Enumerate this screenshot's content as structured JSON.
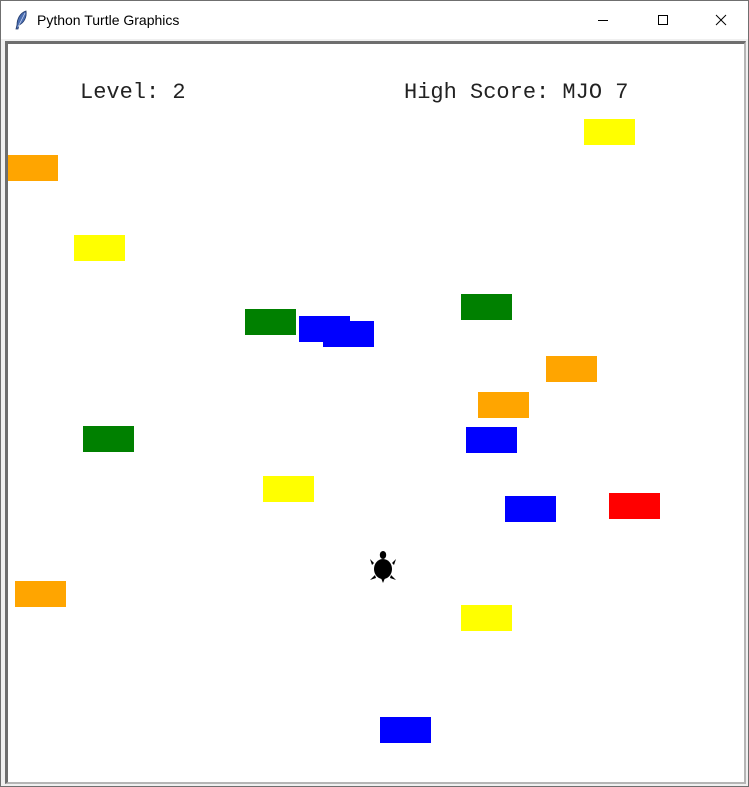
{
  "window": {
    "title": "Python Turtle Graphics",
    "icon": "feather-icon",
    "controls": [
      "minimize-icon",
      "maximize-icon",
      "close-icon"
    ]
  },
  "hud": {
    "level": "Level: 2",
    "high_score": "High Score: MJO 7"
  },
  "colors": {
    "orange": "#ffa500",
    "yellow": "#ffff00",
    "green": "#008000",
    "blue": "#0000ff",
    "red": "#ff0000",
    "turtle": "#000000"
  },
  "player": {
    "shape": "turtle",
    "color": "#000000"
  },
  "blocks": [
    {
      "color": "#ffff00"
    },
    {
      "color": "#ffa500"
    },
    {
      "color": "#ffff00"
    },
    {
      "color": "#008000"
    },
    {
      "color": "#0000ff"
    },
    {
      "color": "#0000ff"
    },
    {
      "color": "#008000"
    },
    {
      "color": "#ffa500"
    },
    {
      "color": "#ffa500"
    },
    {
      "color": "#008000"
    },
    {
      "color": "#0000ff"
    },
    {
      "color": "#ffff00"
    },
    {
      "color": "#0000ff"
    },
    {
      "color": "#ff0000"
    },
    {
      "color": "#ffa500"
    },
    {
      "color": "#ffff00"
    },
    {
      "color": "#0000ff"
    }
  ]
}
